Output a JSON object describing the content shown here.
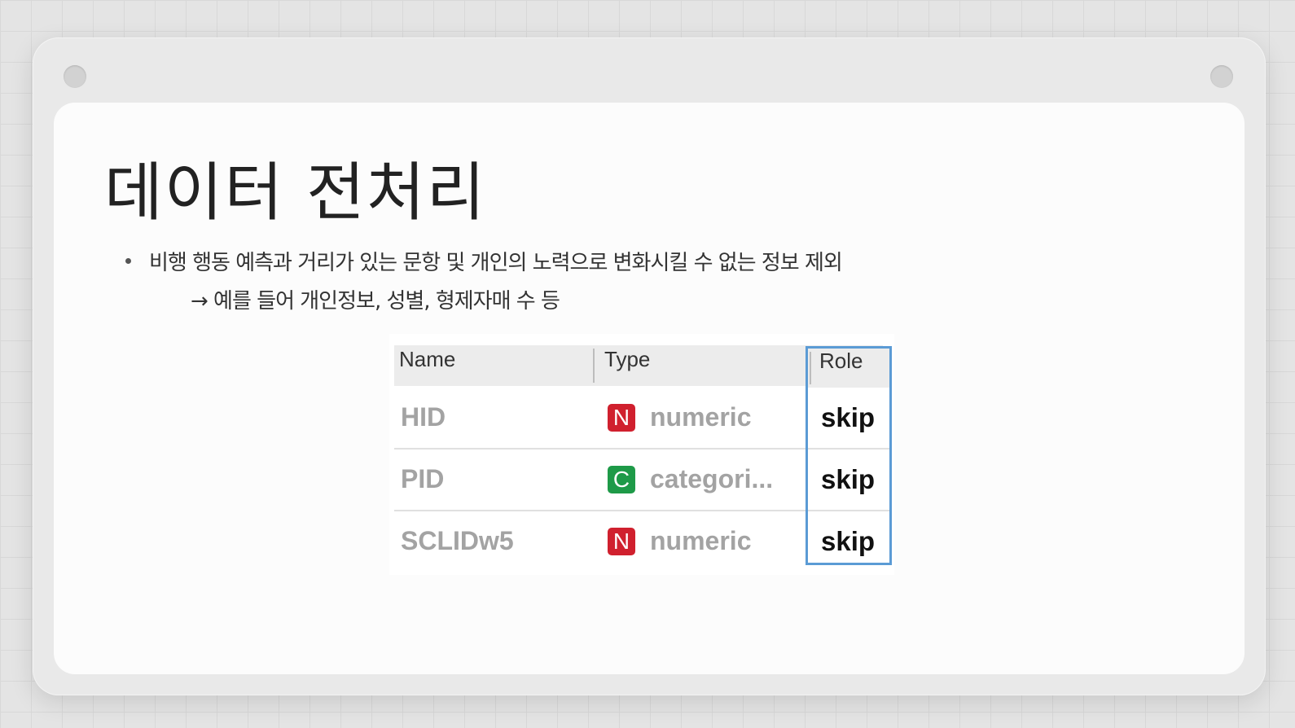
{
  "slide": {
    "title": "데이터 전처리",
    "bullet": "비행 행동 예측과 거리가 있는 문항 및 개인의 노력으로 변화시킬 수 없는 정보 제외",
    "sub_bullet": "→ 예를 들어 개인정보, 성별, 형제자매 수 등"
  },
  "table": {
    "headers": {
      "name": "Name",
      "type": "Type",
      "role": "Role"
    },
    "rows": [
      {
        "name": "HID",
        "badge": "N",
        "badge_color": "#d0202e",
        "type": "numeric",
        "role": "skip"
      },
      {
        "name": "PID",
        "badge": "C",
        "badge_color": "#1e9a48",
        "type": "categori...",
        "role": "skip"
      },
      {
        "name": "SCLIDw5",
        "badge": "N",
        "badge_color": "#d0202e",
        "type": "numeric",
        "role": "skip"
      }
    ],
    "highlight_color": "#5b9bd5"
  }
}
